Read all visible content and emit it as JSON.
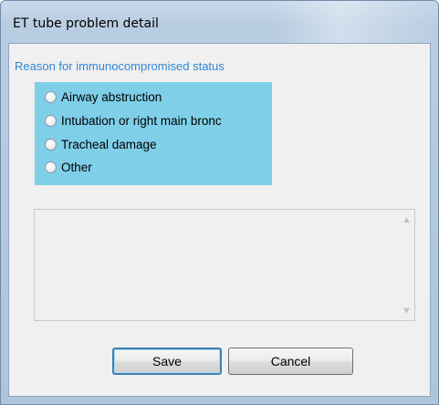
{
  "window": {
    "title": "ET tube problem detail"
  },
  "section": {
    "label": "Reason for immunocompromised status"
  },
  "radio_options": [
    {
      "label": "Airway abstruction",
      "selected": false
    },
    {
      "label": "Intubation or right main bronc",
      "selected": false
    },
    {
      "label": "Tracheal damage",
      "selected": false
    },
    {
      "label": "Other",
      "selected": false
    }
  ],
  "notes": {
    "value": ""
  },
  "buttons": {
    "save_label": "Save",
    "cancel_label": "Cancel"
  },
  "colors": {
    "section_label": "#2f86d6",
    "radio_panel": "#7fcfe8",
    "client_bg": "#f0f0f0"
  }
}
